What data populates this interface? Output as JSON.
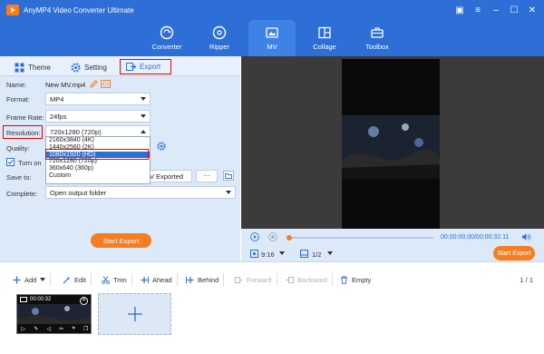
{
  "app": {
    "title": "AnyMP4 Video Converter Ultimate"
  },
  "nav": [
    {
      "label": "Converter",
      "icon": "converter-icon"
    },
    {
      "label": "Ripper",
      "icon": "ripper-icon"
    },
    {
      "label": "MV",
      "icon": "mv-icon"
    },
    {
      "label": "Collage",
      "icon": "collage-icon"
    },
    {
      "label": "Toolbox",
      "icon": "toolbox-icon"
    }
  ],
  "tabs": {
    "theme": "Theme",
    "setting": "Setting",
    "export": "Export"
  },
  "export": {
    "name_label": "Name:",
    "name_value": "New MV.mp4",
    "format_label": "Format:",
    "format_value": "MP4",
    "framerate_label": "Frame Rate:",
    "framerate_value": "24fps",
    "resolution_label": "Resolution:",
    "resolution_value": "720x1280 (720p)",
    "quality_label": "Quality:",
    "turn_on_label": "Turn on",
    "saveto_label": "Save to:",
    "saveto_value": "V Exported",
    "saveto_more": "···",
    "complete_label": "Complete:",
    "complete_value": "Open output folder",
    "start_export": "Start Export"
  },
  "resolution_options": [
    "2160x3840 (4K)",
    "1440x2560 (2K)",
    "1080x1920 (HD)",
    "720x1280 (720p)",
    "360x640 (360p)",
    "Custom"
  ],
  "resolution_selected": "1080x1920 (HD)",
  "player": {
    "time": "00:00:00.00/00:00:32.11",
    "aspect": "9:16",
    "fraction": "1/2",
    "start_export": "Start Export",
    "progress": 0
  },
  "toolbar": {
    "add": "Add",
    "edit": "Edit",
    "trim": "Trim",
    "ahead": "Ahead",
    "behind": "Behind",
    "forward": "Forward",
    "backward": "Backward",
    "empty": "Empty",
    "page": "1 / 1"
  },
  "clip": {
    "duration": "00:00:32"
  },
  "colors": {
    "brand": "#2d6fd6",
    "accent": "#f47e21",
    "panel": "#dce9f8",
    "highlight_border": "#e00000"
  }
}
